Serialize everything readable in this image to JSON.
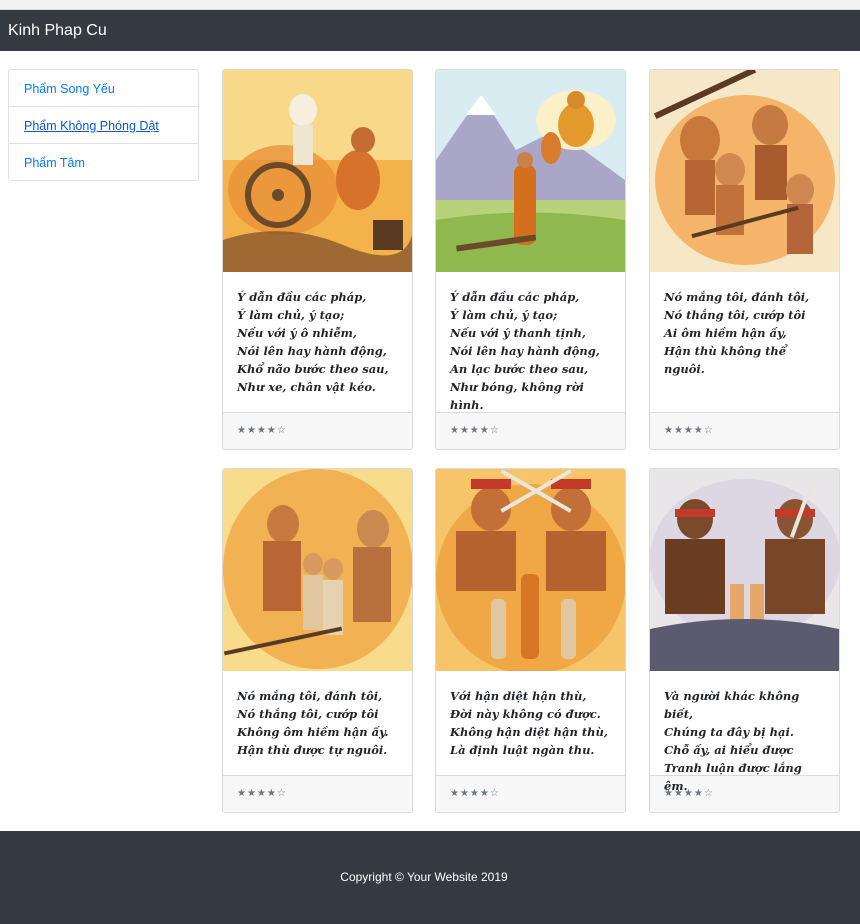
{
  "brand": "Kinh Phap Cu",
  "sidebar": {
    "items": [
      {
        "label": "Phẩm Song Yếu",
        "active": false
      },
      {
        "label": "Phẩm Không Phóng Dật",
        "active": true
      },
      {
        "label": "Phẩm Tâm",
        "active": false
      }
    ]
  },
  "cards": [
    {
      "text": "Ý dẫn đầu các pháp,\nÝ làm chủ, ý tạo;\nNếu với ý ô nhiễm,\nNói lên hay hành động,\nKhổ não bước theo sau,\nNhư xe, chân vật kéo.",
      "rating": "★★★★☆",
      "image": "illustration-cart-skeleton"
    },
    {
      "text": "Ý dẫn đầu các pháp,\nÝ làm chủ, ý tạo;\nNếu với ý thanh tịnh,\nNói lên hay hành động,\nAn lạc bước theo sau,\nNhư bóng, không rời hình.",
      "rating": "★★★★☆",
      "image": "illustration-buddha-monk"
    },
    {
      "text": "Nó mắng tôi, đánh tôi,\nNó thắng tôi, cướp tôi\nAi ôm hiềm hận ấy,\nHận thù không thể nguôi.",
      "rating": "★★★★☆",
      "image": "illustration-fighting-men"
    },
    {
      "text": "Nó mắng tôi, đánh tôi, Nó thắng tôi, cướp tôi Không ôm hiềm hận ấy. Hận thù được tự nguôi.",
      "rating": "★★★★☆",
      "image": "illustration-men-reconciling"
    },
    {
      "text": "Với hận diệt hận thù,\nĐời này không có được.\nKhông hận diệt hận thù,\nLà định luật ngàn thu.",
      "rating": "★★★★☆",
      "image": "illustration-swordsmen-monks"
    },
    {
      "text": "Và người khác không biết,\nChúng ta đây bị hại.\nChỗ ấy, ai hiểu được\nTranh luận được lắng êm.",
      "rating": "★★★★☆",
      "image": "illustration-warriors-battlefield"
    }
  ],
  "footer": {
    "copyright": "Copyright © Your Website 2019"
  },
  "colors": {
    "navbar": "#343a40",
    "link": "#007bff",
    "footer": "#343a40"
  }
}
